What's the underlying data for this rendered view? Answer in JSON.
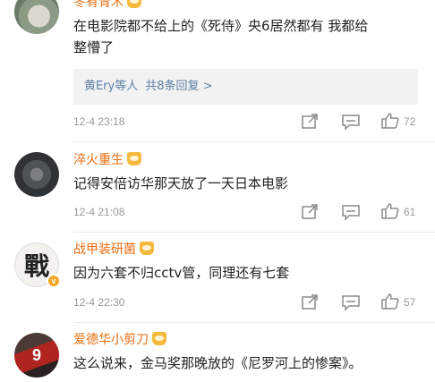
{
  "comments": [
    {
      "username": "冬有青木",
      "text_line1": "在电影院都不给上的《死侍》央6居然都有 我都给",
      "text_line2": "整懵了",
      "replies": {
        "names": "黄Ery等人",
        "count_text": "共8条回复 >"
      },
      "date": "12-4 23:18",
      "likes": "72"
    },
    {
      "username": "淬火重生",
      "text_line1": "记得安倍访华那天放了一天日本电影",
      "date": "12-4 21:08",
      "likes": "61"
    },
    {
      "username": "战甲装研菌",
      "text_line1": "因为六套不归cctv管，同理还有七套",
      "date": "12-4 22:30",
      "likes": "57"
    },
    {
      "username": "爱德华小剪刀",
      "text_line1": "这么说来，金马奖那晚放的《尼罗河上的惨案》。"
    }
  ],
  "icons": {
    "share": "share-icon",
    "comment": "comment-icon",
    "like": "like-icon",
    "vip": "vip-crown-icon",
    "verified": "verified-badge-icon"
  },
  "colors": {
    "username": "#e86b0f",
    "link": "#5d7ea6",
    "meta": "#999999"
  },
  "avatar_glyphs": {
    "a3": "戰",
    "a4": "9"
  }
}
